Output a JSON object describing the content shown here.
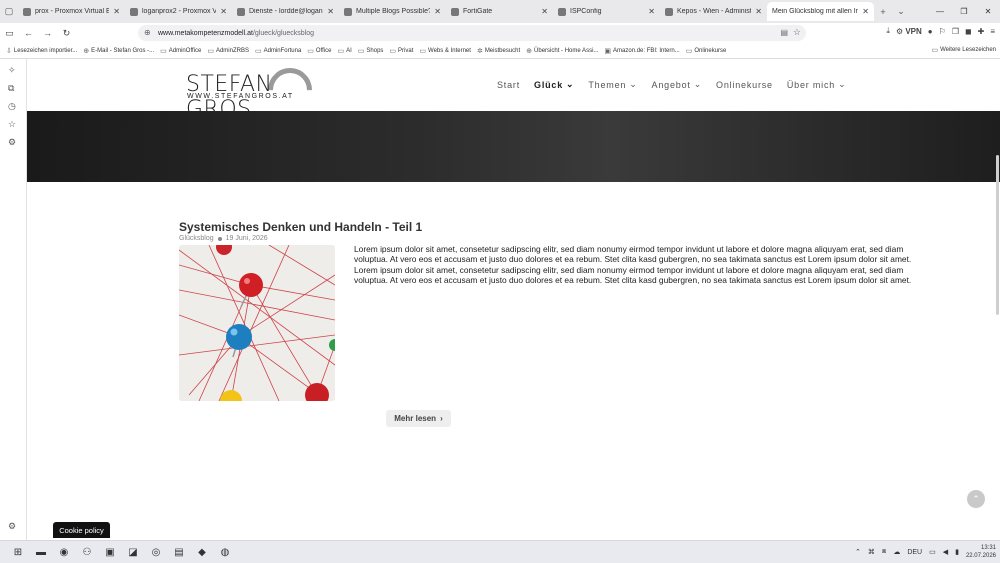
{
  "browser": {
    "tabs": [
      {
        "title": "prox - Proxmox Virtual Envi",
        "active": false
      },
      {
        "title": "loganprox2 - Proxmox Virt",
        "active": false
      },
      {
        "title": "Dienste - lordde@logan.us",
        "active": false
      },
      {
        "title": "Multiple Blogs Possible? - C",
        "active": false
      },
      {
        "title": "FortiGate",
        "active": false
      },
      {
        "title": "ISPConfig",
        "active": false
      },
      {
        "title": "Kepos - Wien - Administrat",
        "active": false
      },
      {
        "title": "Mein Glücksblog mit allen Ir",
        "active": true
      }
    ],
    "url_host": "www.metakompetenzmodell.at",
    "url_path": "/glueck/gluecksblog",
    "vpn_label": "VPN",
    "bookmarks": [
      "Lesezeichen importier...",
      "E-Mail - Stefan Gros -...",
      "AdminOffice",
      "AdminZRBS",
      "AdminFortuna",
      "Office",
      "AI",
      "Shops",
      "Privat",
      "Webs & Internet",
      "Meistbesucht",
      "Übersicht - Home Assi...",
      "Amazon.de: FBI: Intern...",
      "Onlinekurse"
    ],
    "bookmarks_right": "Weitere Lesezeichen"
  },
  "site": {
    "logo_text": "STEFAN GROS",
    "logo_sub": "WWW.STEFANGROS.AT",
    "nav": [
      {
        "label": "Start",
        "dropdown": false,
        "current": false
      },
      {
        "label": "Glück",
        "dropdown": true,
        "current": true
      },
      {
        "label": "Themen",
        "dropdown": true,
        "current": false
      },
      {
        "label": "Angebot",
        "dropdown": true,
        "current": false
      },
      {
        "label": "Onlinekurse",
        "dropdown": false,
        "current": false
      },
      {
        "label": "Über mich",
        "dropdown": true,
        "current": false
      }
    ],
    "post": {
      "title": "Systemisches Denken und Handeln - Teil 1",
      "category": "Glücksblog",
      "date": "19 Juni, 2026",
      "excerpt": "Lorem ipsum dolor sit amet, consetetur sadipscing elitr, sed diam nonumy eirmod tempor invidunt ut labore et dolore magna aliquyam erat, sed diam voluptua. At vero eos et accusam et justo duo dolores et ea rebum. Stet clita kasd gubergren, no sea takimata sanctus est Lorem ipsum dolor sit amet. Lorem ipsum dolor sit amet, consetetur sadipscing elitr, sed diam nonumy eirmod tempor invidunt ut labore et dolore magna aliquyam erat, sed diam voluptua. At vero eos et accusam et justo duo dolores et ea rebum. Stet clita kasd gubergren, no sea takimata sanctus est Lorem ipsum dolor sit amet.",
      "more_label": "Mehr lesen"
    },
    "cookie_label": "Cookie policy"
  },
  "taskbar": {
    "lang": "DEU",
    "time": "13:31",
    "date": "22.07.2026"
  },
  "colors": {
    "hero_dark": "#1a1a1a",
    "logo_arc": "#9a9a9a",
    "button_bg": "#eeeeee"
  }
}
